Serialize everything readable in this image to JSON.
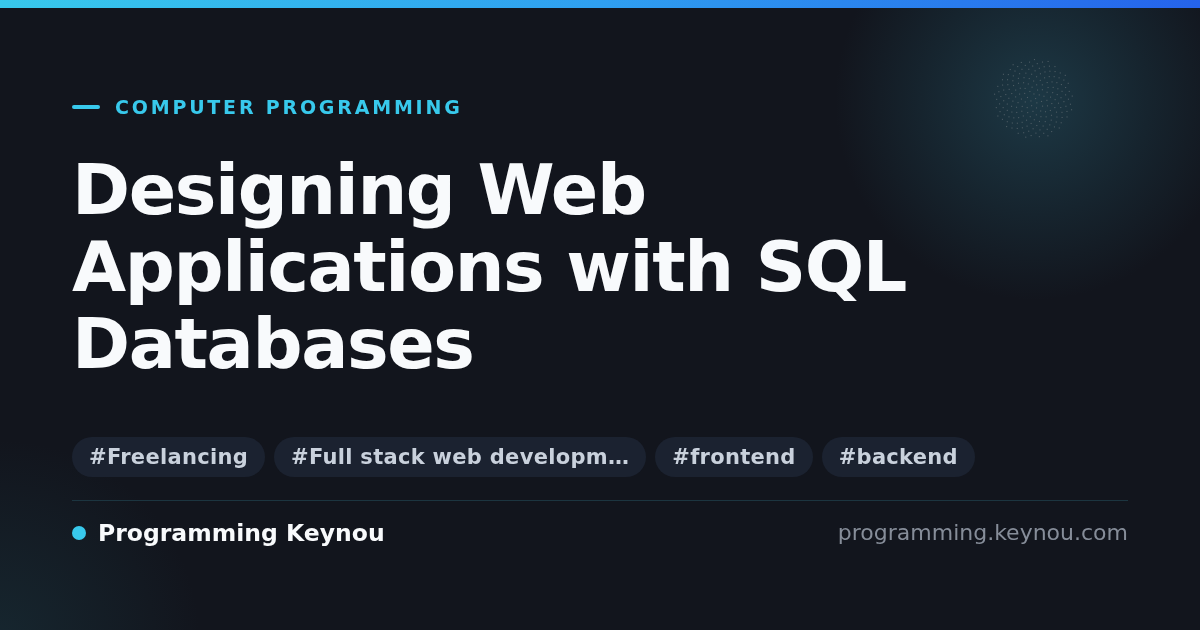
{
  "category": "COMPUTER PROGRAMMING",
  "title": "Designing Web Applications with SQL Databases",
  "tags": [
    "#Freelancing",
    "#Full stack web developm…",
    "#frontend",
    "#backend"
  ],
  "footer": {
    "site_name": "Programming Keynou",
    "url": "programming.keynou.com"
  }
}
